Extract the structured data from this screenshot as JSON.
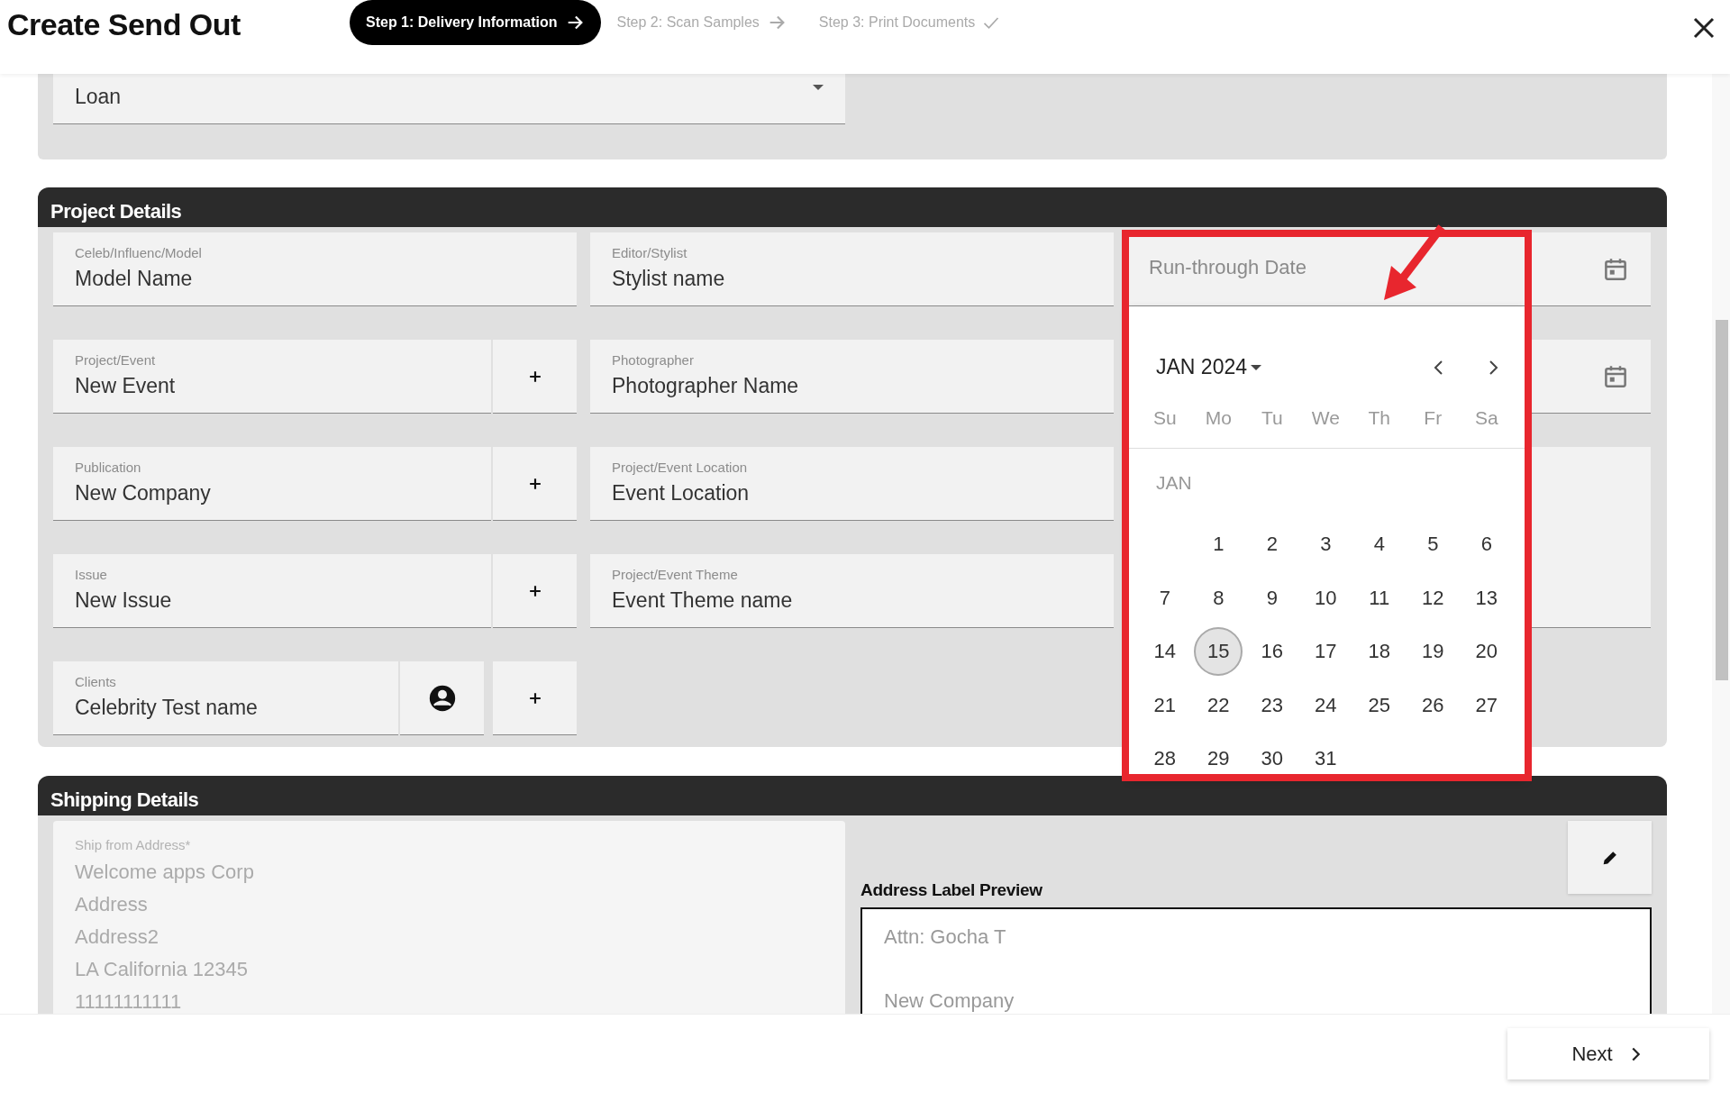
{
  "header": {
    "title": "Create Send Out",
    "steps": [
      {
        "label": "Step 1: Delivery Information",
        "kind": "arrow",
        "selected": true
      },
      {
        "label": "Step 2: Scan Samples",
        "kind": "arrow",
        "selected": false
      },
      {
        "label": "Step 3: Print Documents",
        "kind": "check",
        "selected": false
      }
    ]
  },
  "top_panel": {
    "fields": [
      {
        "kind": "select",
        "value": "Loan"
      }
    ]
  },
  "project_details": {
    "title": "Project Details",
    "columns": [
      [
        {
          "kind": "text",
          "label": "Celeb/Influenc/Model",
          "value": "Model Name"
        },
        {
          "kind": "add",
          "label": "Project/Event",
          "value": "New Event"
        },
        {
          "kind": "add",
          "label": "Publication",
          "value": "New Company"
        },
        {
          "kind": "add",
          "label": "Issue",
          "value": "New Issue"
        },
        {
          "kind": "client",
          "label": "Clients",
          "value": "Celebrity Test name"
        }
      ],
      [
        {
          "kind": "text",
          "label": "Editor/Stylist",
          "value": "Stylist name"
        },
        {
          "kind": "text",
          "label": "Photographer",
          "value": "Photographer Name"
        },
        {
          "kind": "text",
          "label": "Project/Event Location",
          "value": "Event Location"
        },
        {
          "kind": "text",
          "label": "Project/Event Theme",
          "value": "Event Theme name"
        }
      ],
      [
        {
          "kind": "date",
          "placeholder": "Run-through Date"
        },
        {
          "kind": "date"
        },
        {
          "kind": "area"
        }
      ]
    ]
  },
  "date_picker": {
    "month": "JAN 2024",
    "weekdays": [
      "Su",
      "Mo",
      "Tu",
      "We",
      "Th",
      "Fr",
      "Sa"
    ],
    "section": "JAN",
    "weeks": [
      [
        {
          "label": "1",
          "selected": false
        },
        {
          "label": "2",
          "selected": false
        },
        {
          "label": "3",
          "selected": false
        },
        {
          "label": "4",
          "selected": false
        },
        {
          "label": "5",
          "selected": false
        },
        {
          "label": "6",
          "selected": false
        }
      ],
      [
        {
          "label": "7",
          "selected": false
        },
        {
          "label": "8",
          "selected": false
        },
        {
          "label": "9",
          "selected": false
        },
        {
          "label": "10",
          "selected": false
        },
        {
          "label": "11",
          "selected": false
        },
        {
          "label": "12",
          "selected": false
        },
        {
          "label": "13",
          "selected": false
        }
      ],
      [
        {
          "label": "14",
          "selected": false
        },
        {
          "label": "15",
          "selected": true
        },
        {
          "label": "16",
          "selected": false
        },
        {
          "label": "17",
          "selected": false
        },
        {
          "label": "18",
          "selected": false
        },
        {
          "label": "19",
          "selected": false
        },
        {
          "label": "20",
          "selected": false
        }
      ],
      [
        {
          "label": "21",
          "selected": false
        },
        {
          "label": "22",
          "selected": false
        },
        {
          "label": "23",
          "selected": false
        },
        {
          "label": "24",
          "selected": false
        },
        {
          "label": "25",
          "selected": false
        },
        {
          "label": "26",
          "selected": false
        },
        {
          "label": "27",
          "selected": false
        }
      ],
      [
        {
          "label": "28",
          "selected": false
        },
        {
          "label": "29",
          "selected": false
        },
        {
          "label": "30",
          "selected": false
        },
        {
          "label": "31",
          "selected": false
        }
      ]
    ]
  },
  "shipping_details": {
    "title": "Shipping Details",
    "ship_from": {
      "label": "Ship from Address*",
      "lines": [
        "Welcome apps Corp",
        "Address",
        "Address2",
        "LA California 12345",
        "11111111111"
      ]
    },
    "preview": {
      "title": "Address Label Preview",
      "lines": [
        "Attn: Gocha T",
        "New Company"
      ]
    }
  },
  "footer": {
    "next": "Next"
  }
}
